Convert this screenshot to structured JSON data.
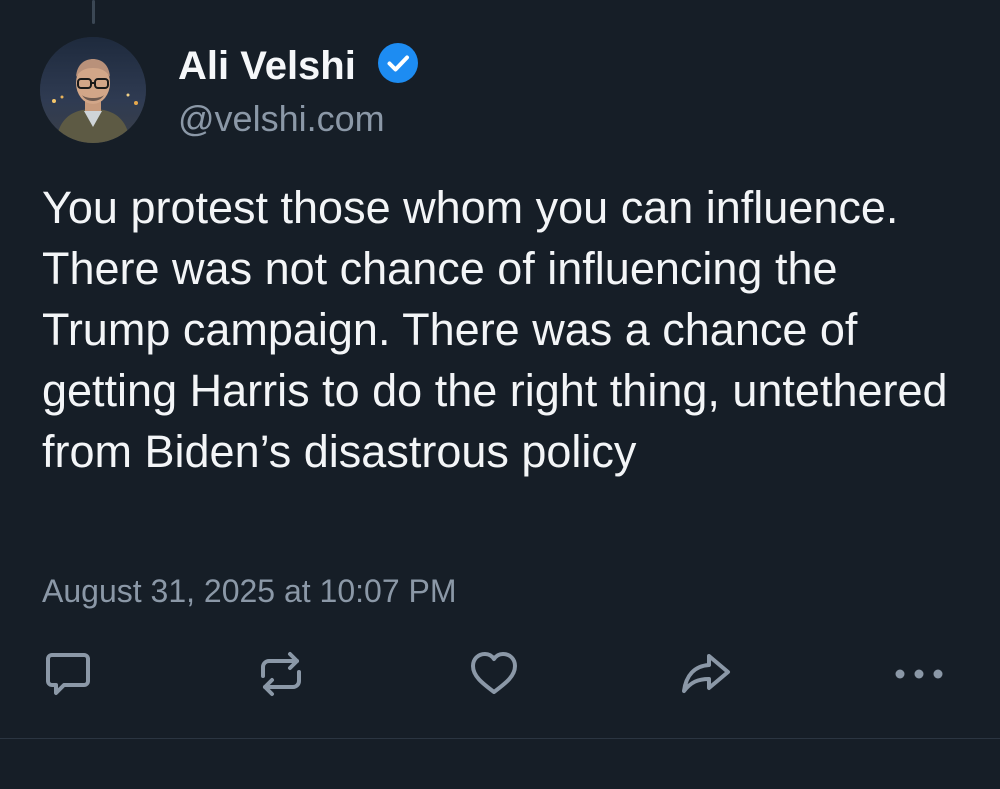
{
  "post": {
    "author": {
      "name": "Ali Velshi",
      "handle": "@velshi.com",
      "verified": true
    },
    "text": "You protest those whom you can influence. There was not chance of influencing the Trump campaign. There was a chance of getting Harris to do the right thing, untethered from Biden’s disastrous policy",
    "timestamp": "August 31, 2025 at 10:07 PM"
  },
  "actions": [
    {
      "name": "reply",
      "icon": "speech-bubble-icon"
    },
    {
      "name": "repost",
      "icon": "repost-arrows-icon"
    },
    {
      "name": "like",
      "icon": "heart-icon"
    },
    {
      "name": "share",
      "icon": "share-arrow-icon"
    },
    {
      "name": "more",
      "icon": "ellipsis-icon"
    }
  ],
  "colors": {
    "background": "#161e27",
    "text_primary": "#f3f5f7",
    "text_secondary": "#8b98a7",
    "icon": "#8b98a7",
    "verified_badge": "#1d8cf2"
  }
}
